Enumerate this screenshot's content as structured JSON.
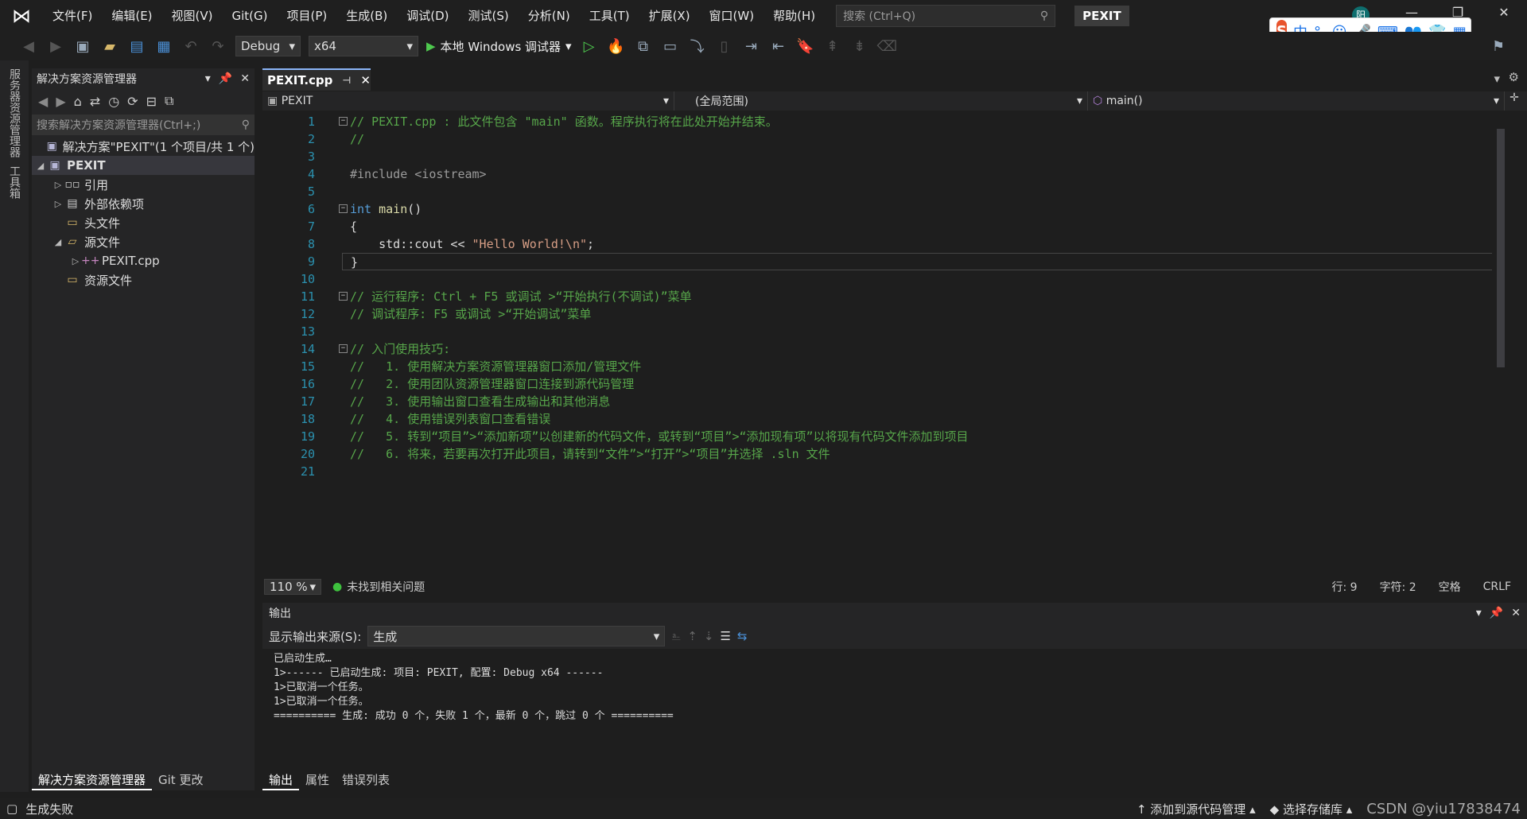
{
  "title_bar": {
    "menu": [
      "文件(F)",
      "编辑(E)",
      "视图(V)",
      "Git(G)",
      "项目(P)",
      "生成(B)",
      "调试(D)",
      "测试(S)",
      "分析(N)",
      "工具(T)",
      "扩展(X)",
      "窗口(W)",
      "帮助(H)"
    ],
    "search_placeholder": "搜索 (Ctrl+Q)",
    "project_badge": "PEXIT",
    "user_initial": "阳",
    "ime": {
      "logo": "S",
      "items": [
        "中",
        "°,",
        "☺",
        "🎤",
        "⌨",
        "👥",
        "👕",
        "▦"
      ]
    }
  },
  "toolbar": {
    "config": "Debug",
    "platform": "x64",
    "debugger_label": "本地 Windows 调试器"
  },
  "left_rail": {
    "server_explorer": "服务器资源管理器",
    "toolbox": "工具箱"
  },
  "solution_explorer": {
    "title": "解决方案资源管理器",
    "search_placeholder": "搜索解决方案资源管理器(Ctrl+;)",
    "tree": [
      {
        "label": "解决方案\"PEXIT\"(1 个项目/共 1 个)",
        "icon": "solution-icon",
        "level": 0,
        "arrow": ""
      },
      {
        "label": "PEXIT",
        "icon": "project-icon",
        "level": 0,
        "arrow": "◢",
        "selected": true
      },
      {
        "label": "引用",
        "icon": "references-icon",
        "level": 1,
        "arrow": "▷"
      },
      {
        "label": "外部依赖项",
        "icon": "external-deps-icon",
        "level": 1,
        "arrow": "▷"
      },
      {
        "label": "头文件",
        "icon": "folder-icon",
        "level": 1,
        "arrow": ""
      },
      {
        "label": "源文件",
        "icon": "folder-open-icon",
        "level": 1,
        "arrow": "◢"
      },
      {
        "label": "PEXIT.cpp",
        "icon": "cpp-file-icon",
        "level": 2,
        "arrow": "▷"
      },
      {
        "label": "资源文件",
        "icon": "folder-icon",
        "level": 1,
        "arrow": ""
      }
    ],
    "bottom_tabs": [
      "解决方案资源管理器",
      "Git 更改"
    ]
  },
  "editor": {
    "tab_label": "PEXIT.cpp",
    "nav_project": "PEXIT",
    "nav_scope": "(全局范围)",
    "nav_member": "main()",
    "zoom": "110 %",
    "issues": "未找到相关问题",
    "line_pos": "行: 9",
    "char_pos": "字符: 2",
    "whitespace": "空格",
    "line_ending": "CRLF",
    "line_numbers": [
      "1",
      "2",
      "3",
      "4",
      "5",
      "6",
      "7",
      "8",
      "9",
      "10",
      "11",
      "12",
      "13",
      "14",
      "15",
      "16",
      "17",
      "18",
      "19",
      "20",
      "21"
    ],
    "code_lines": [
      "// PEXIT.cpp : 此文件包含 \"main\" 函数。程序执行将在此处开始并结束。",
      "//",
      "",
      "#include <iostream>",
      "",
      "int main()",
      "{",
      "    std::cout << \"Hello World!\\n\";",
      "}",
      "",
      "// 运行程序: Ctrl + F5 或调试 >“开始执行(不调试)”菜单",
      "// 调试程序: F5 或调试 >“开始调试”菜单",
      "",
      "// 入门使用技巧:",
      "//   1. 使用解决方案资源管理器窗口添加/管理文件",
      "//   2. 使用团队资源管理器窗口连接到源代码管理",
      "//   3. 使用输出窗口查看生成输出和其他消息",
      "//   4. 使用错误列表窗口查看错误",
      "//   5. 转到“项目”>“添加新项”以创建新的代码文件，或转到“项目”>“添加现有项”以将现有代码文件添加到项目",
      "//   6. 将来，若要再次打开此项目，请转到“文件”>“打开”>“项目”并选择 .sln 文件",
      ""
    ]
  },
  "output": {
    "title": "输出",
    "source_label": "显示输出来源(S):",
    "source_value": "生成",
    "lines": [
      "已启动生成…",
      "1>------ 已启动生成: 项目: PEXIT, 配置: Debug x64 ------",
      "1>已取消一个任务。",
      "1>已取消一个任务。",
      "========== 生成: 成功 0 个，失败 1 个，最新 0 个，跳过 0 个 =========="
    ],
    "tabs": [
      "输出",
      "属性",
      "错误列表"
    ]
  },
  "status_bar": {
    "left": "生成失败",
    "add_source_control": "添加到源代码管理",
    "select_repo": "选择存储库",
    "watermark": "CSDN @yiu17838474"
  }
}
